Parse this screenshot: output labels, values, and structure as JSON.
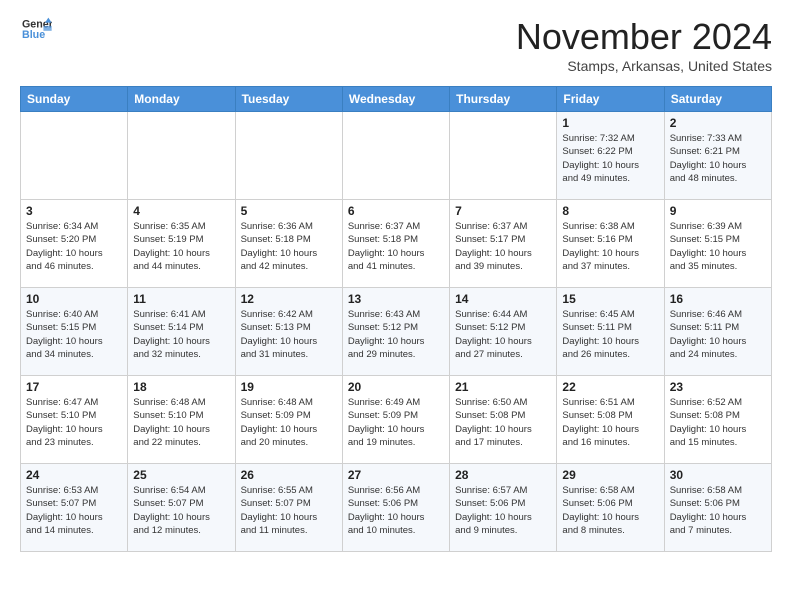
{
  "header": {
    "logo_line1": "General",
    "logo_line2": "Blue",
    "month": "November 2024",
    "location": "Stamps, Arkansas, United States"
  },
  "days_of_week": [
    "Sunday",
    "Monday",
    "Tuesday",
    "Wednesday",
    "Thursday",
    "Friday",
    "Saturday"
  ],
  "weeks": [
    [
      {
        "day": "",
        "info": ""
      },
      {
        "day": "",
        "info": ""
      },
      {
        "day": "",
        "info": ""
      },
      {
        "day": "",
        "info": ""
      },
      {
        "day": "",
        "info": ""
      },
      {
        "day": "1",
        "info": "Sunrise: 7:32 AM\nSunset: 6:22 PM\nDaylight: 10 hours\nand 49 minutes."
      },
      {
        "day": "2",
        "info": "Sunrise: 7:33 AM\nSunset: 6:21 PM\nDaylight: 10 hours\nand 48 minutes."
      }
    ],
    [
      {
        "day": "3",
        "info": "Sunrise: 6:34 AM\nSunset: 5:20 PM\nDaylight: 10 hours\nand 46 minutes."
      },
      {
        "day": "4",
        "info": "Sunrise: 6:35 AM\nSunset: 5:19 PM\nDaylight: 10 hours\nand 44 minutes."
      },
      {
        "day": "5",
        "info": "Sunrise: 6:36 AM\nSunset: 5:18 PM\nDaylight: 10 hours\nand 42 minutes."
      },
      {
        "day": "6",
        "info": "Sunrise: 6:37 AM\nSunset: 5:18 PM\nDaylight: 10 hours\nand 41 minutes."
      },
      {
        "day": "7",
        "info": "Sunrise: 6:37 AM\nSunset: 5:17 PM\nDaylight: 10 hours\nand 39 minutes."
      },
      {
        "day": "8",
        "info": "Sunrise: 6:38 AM\nSunset: 5:16 PM\nDaylight: 10 hours\nand 37 minutes."
      },
      {
        "day": "9",
        "info": "Sunrise: 6:39 AM\nSunset: 5:15 PM\nDaylight: 10 hours\nand 35 minutes."
      }
    ],
    [
      {
        "day": "10",
        "info": "Sunrise: 6:40 AM\nSunset: 5:15 PM\nDaylight: 10 hours\nand 34 minutes."
      },
      {
        "day": "11",
        "info": "Sunrise: 6:41 AM\nSunset: 5:14 PM\nDaylight: 10 hours\nand 32 minutes."
      },
      {
        "day": "12",
        "info": "Sunrise: 6:42 AM\nSunset: 5:13 PM\nDaylight: 10 hours\nand 31 minutes."
      },
      {
        "day": "13",
        "info": "Sunrise: 6:43 AM\nSunset: 5:12 PM\nDaylight: 10 hours\nand 29 minutes."
      },
      {
        "day": "14",
        "info": "Sunrise: 6:44 AM\nSunset: 5:12 PM\nDaylight: 10 hours\nand 27 minutes."
      },
      {
        "day": "15",
        "info": "Sunrise: 6:45 AM\nSunset: 5:11 PM\nDaylight: 10 hours\nand 26 minutes."
      },
      {
        "day": "16",
        "info": "Sunrise: 6:46 AM\nSunset: 5:11 PM\nDaylight: 10 hours\nand 24 minutes."
      }
    ],
    [
      {
        "day": "17",
        "info": "Sunrise: 6:47 AM\nSunset: 5:10 PM\nDaylight: 10 hours\nand 23 minutes."
      },
      {
        "day": "18",
        "info": "Sunrise: 6:48 AM\nSunset: 5:10 PM\nDaylight: 10 hours\nand 22 minutes."
      },
      {
        "day": "19",
        "info": "Sunrise: 6:48 AM\nSunset: 5:09 PM\nDaylight: 10 hours\nand 20 minutes."
      },
      {
        "day": "20",
        "info": "Sunrise: 6:49 AM\nSunset: 5:09 PM\nDaylight: 10 hours\nand 19 minutes."
      },
      {
        "day": "21",
        "info": "Sunrise: 6:50 AM\nSunset: 5:08 PM\nDaylight: 10 hours\nand 17 minutes."
      },
      {
        "day": "22",
        "info": "Sunrise: 6:51 AM\nSunset: 5:08 PM\nDaylight: 10 hours\nand 16 minutes."
      },
      {
        "day": "23",
        "info": "Sunrise: 6:52 AM\nSunset: 5:08 PM\nDaylight: 10 hours\nand 15 minutes."
      }
    ],
    [
      {
        "day": "24",
        "info": "Sunrise: 6:53 AM\nSunset: 5:07 PM\nDaylight: 10 hours\nand 14 minutes."
      },
      {
        "day": "25",
        "info": "Sunrise: 6:54 AM\nSunset: 5:07 PM\nDaylight: 10 hours\nand 12 minutes."
      },
      {
        "day": "26",
        "info": "Sunrise: 6:55 AM\nSunset: 5:07 PM\nDaylight: 10 hours\nand 11 minutes."
      },
      {
        "day": "27",
        "info": "Sunrise: 6:56 AM\nSunset: 5:06 PM\nDaylight: 10 hours\nand 10 minutes."
      },
      {
        "day": "28",
        "info": "Sunrise: 6:57 AM\nSunset: 5:06 PM\nDaylight: 10 hours\nand 9 minutes."
      },
      {
        "day": "29",
        "info": "Sunrise: 6:58 AM\nSunset: 5:06 PM\nDaylight: 10 hours\nand 8 minutes."
      },
      {
        "day": "30",
        "info": "Sunrise: 6:58 AM\nSunset: 5:06 PM\nDaylight: 10 hours\nand 7 minutes."
      }
    ]
  ]
}
